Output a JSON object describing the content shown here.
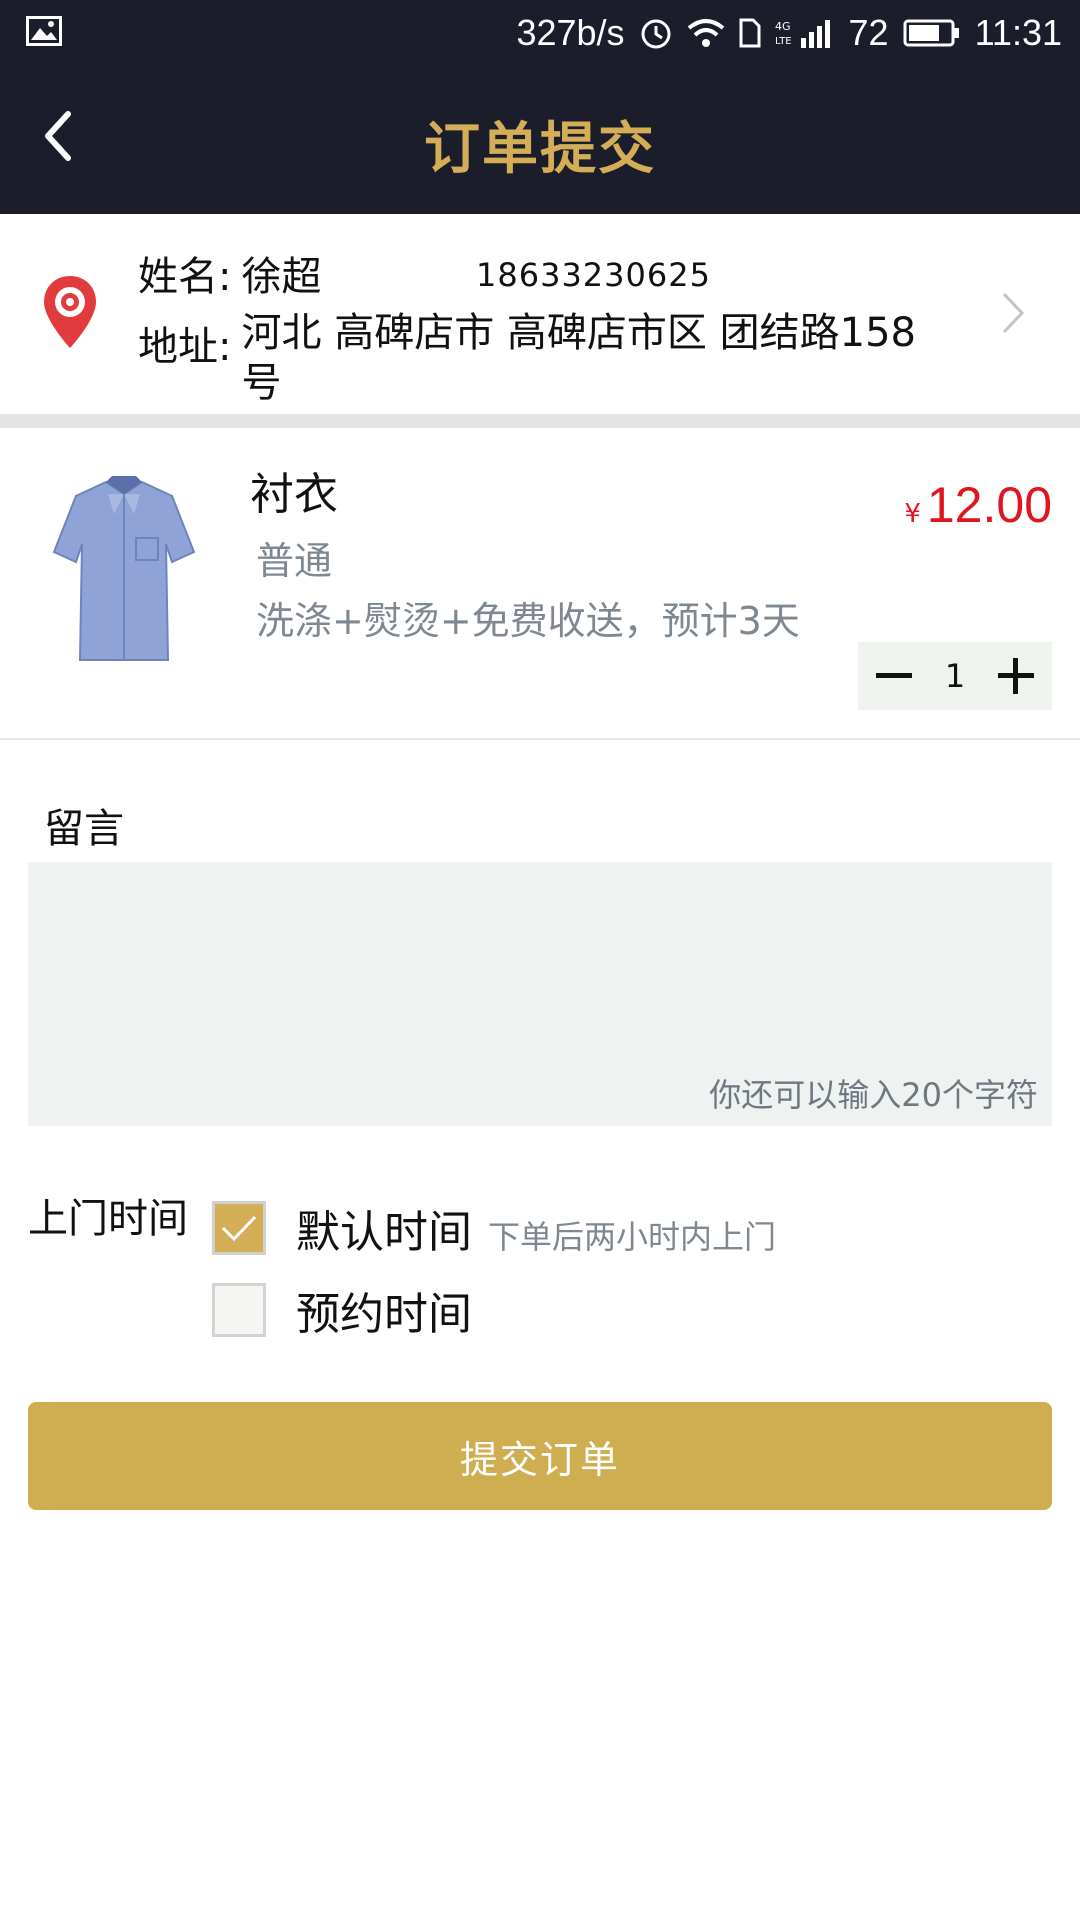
{
  "status_bar": {
    "net_speed": "327b/s",
    "battery": "72",
    "time": "11:31",
    "net_type": "4G LTE",
    "icons": [
      "image-icon",
      "alarm-icon",
      "wifi-icon",
      "sim-icon",
      "signal-icon",
      "battery-icon"
    ]
  },
  "header": {
    "title": "订单提交",
    "back_icon": "back-arrow-icon",
    "accent_color": "#d4ad57",
    "background_color": "#1b1d2b"
  },
  "address": {
    "name_label": "姓名:",
    "name": "徐超",
    "phone": "18633230625",
    "address_label": "地址:",
    "address": "河北 高碑店市 高碑店市区 团结路158号",
    "pin_icon": "location-pin-icon",
    "chevron_icon": "chevron-right-icon"
  },
  "product": {
    "name": "衬衣",
    "grade": "普通",
    "description": "洗涤+熨烫+免费收送，预计3天",
    "price_symbol": "¥",
    "price": "12.00",
    "quantity": "1",
    "image": "shirt-image",
    "price_color": "#e0151f"
  },
  "message": {
    "label": "留言",
    "value": "",
    "counter": "你还可以输入20个字符"
  },
  "visit_time": {
    "label": "上门时间",
    "options": [
      {
        "label": "默认时间",
        "hint": "下单后两小时内上门",
        "checked": true
      },
      {
        "label": "预约时间",
        "hint": "",
        "checked": false
      }
    ]
  },
  "submit": {
    "label": "提交订单",
    "color": "#cfae52"
  }
}
